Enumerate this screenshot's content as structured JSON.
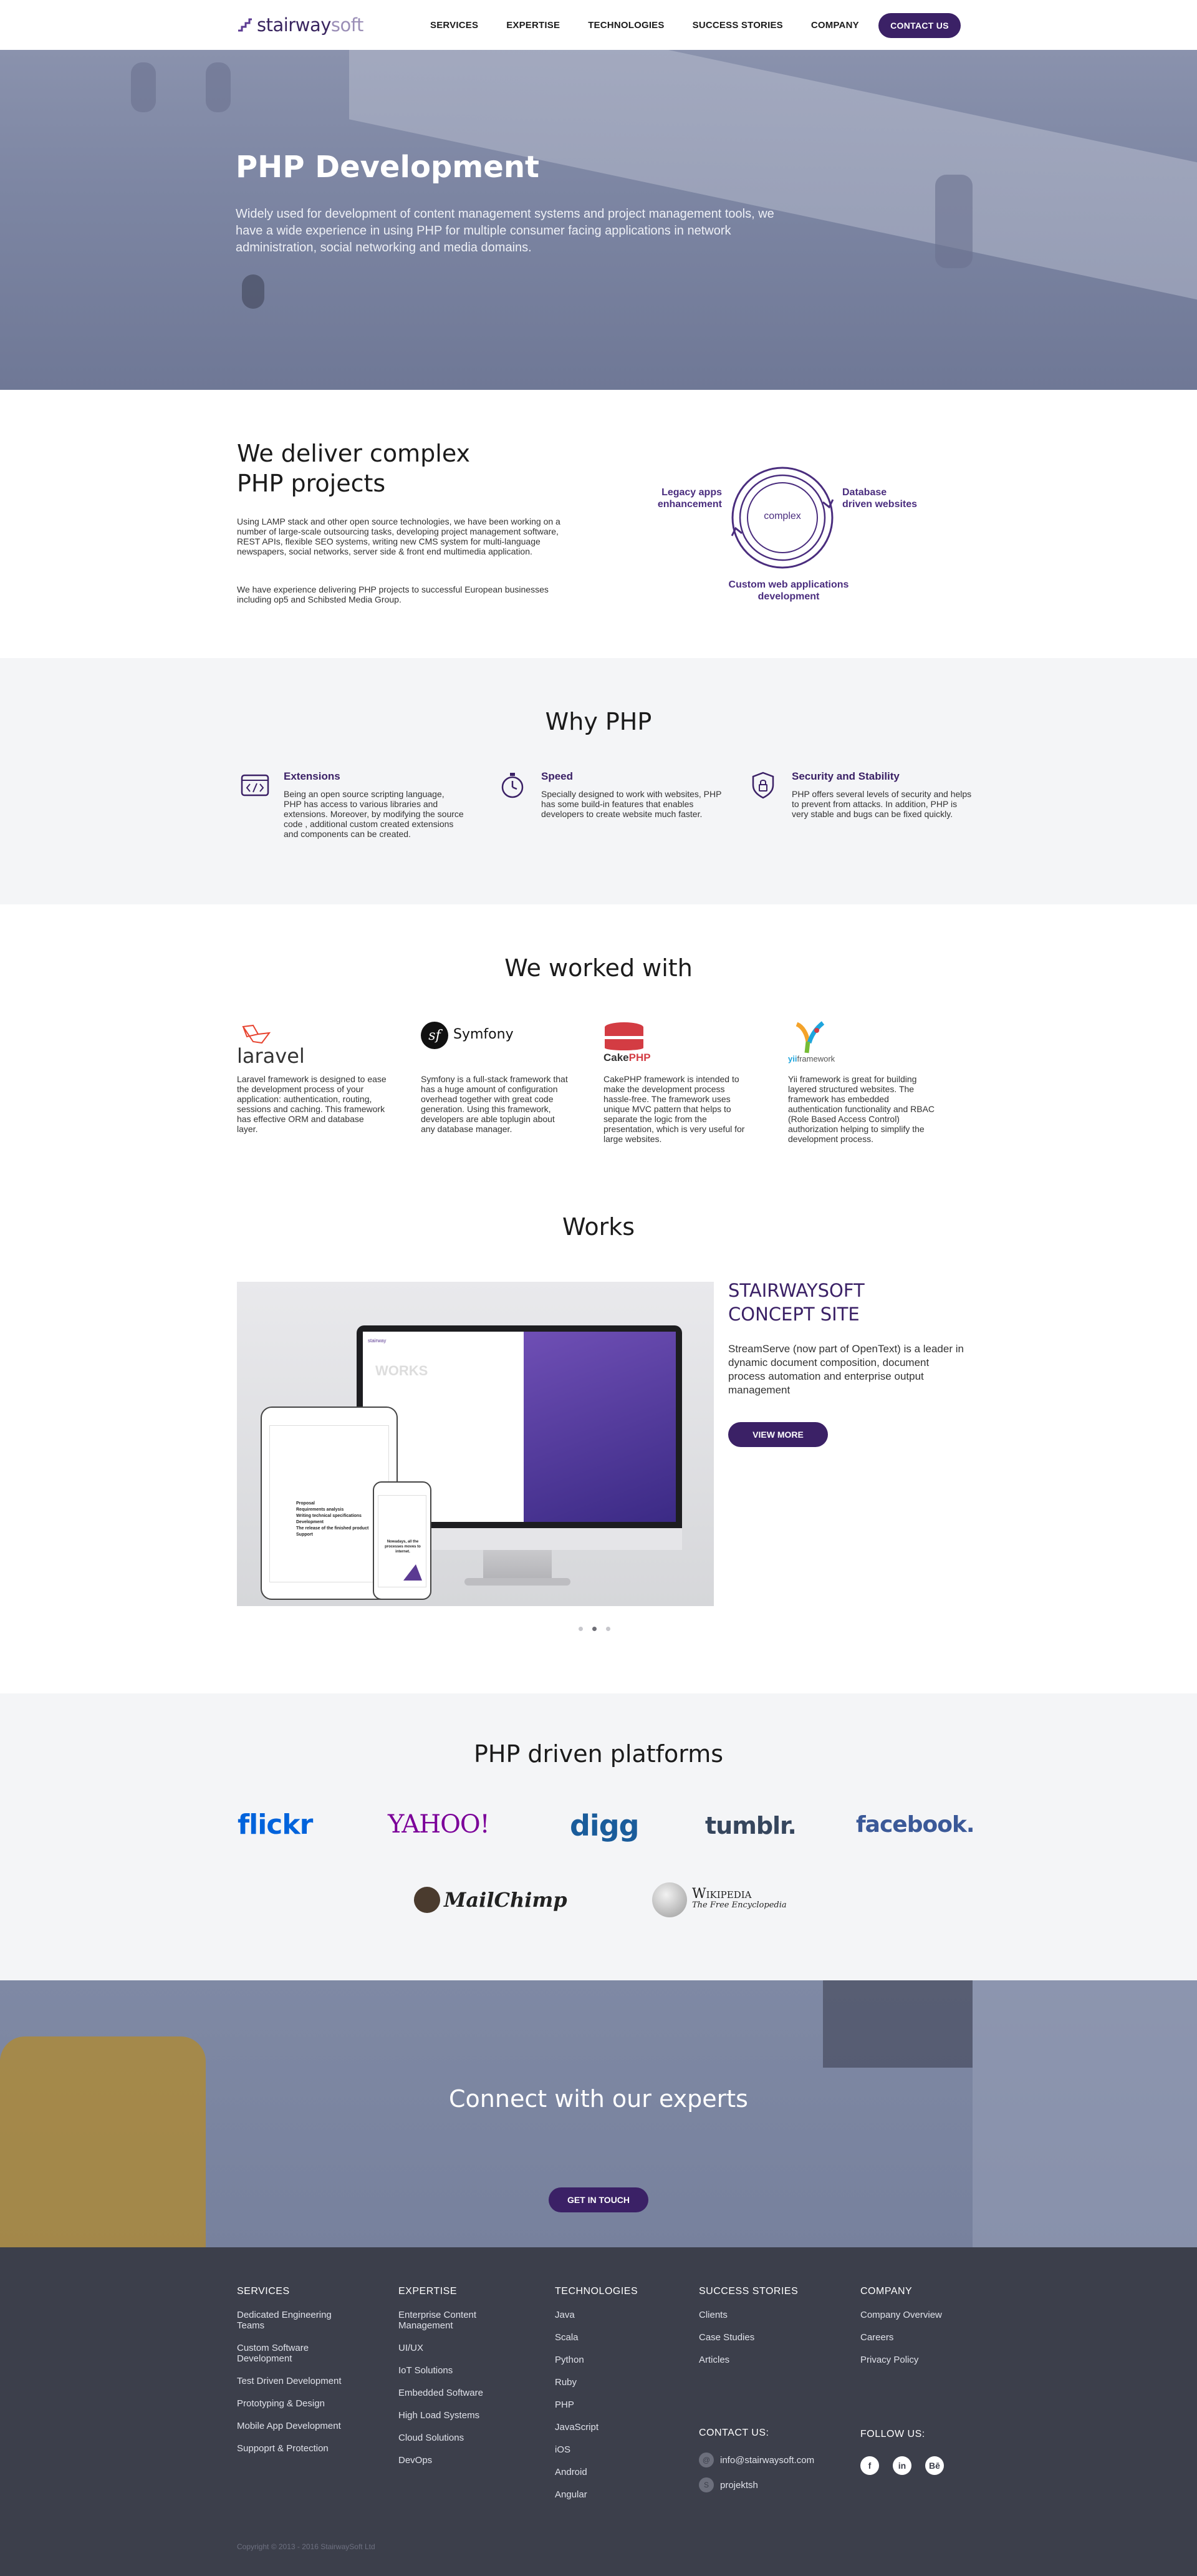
{
  "header": {
    "logo": {
      "part1": "stairway",
      "part2": "soft"
    },
    "nav": [
      "SERVICES",
      "EXPERTISE",
      "TECHNOLOGIES",
      "SUCCESS STORIES",
      "COMPANY"
    ],
    "contact_label": "CONTACT US"
  },
  "hero": {
    "title": "PHP Development",
    "description": "Widely used for development of content management systems and project management tools, we have a wide experience in using PHP for multiple consumer facing applications in network administration, social networking and media domains."
  },
  "deliver": {
    "title_line1": "We deliver complex",
    "title_line2": "PHP projects",
    "paragraph1": "Using LAMP stack and other open source technologies, we have been working on a number of large-scale outsourcing tasks, developing project management software, REST APIs, flexible SEO systems, writing new CMS system for multi-language newspapers, social networks, server side & front end multimedia application.",
    "paragraph2": "We have experience delivering PHP projects to successful European businesses including op5 and Schibsted Media Group.",
    "diagram": {
      "center": "complex",
      "left_line1": "Legacy apps",
      "left_line2": "enhancement",
      "right_line1": "Database",
      "right_line2": "driven websites",
      "bottom_line1": "Custom web applications",
      "bottom_line2": "development"
    }
  },
  "why": {
    "title": "Why PHP",
    "features": [
      {
        "icon": "code-window-icon",
        "title": "Extensions",
        "text": "Being an open source scripting language, PHP has access to various libraries and extensions. Moreover, by modifying the source code , additional custom created extensions and components can be created."
      },
      {
        "icon": "stopwatch-icon",
        "title": "Speed",
        "text": "Specially designed to work with websites, PHP has some build-in features that enables developers to create website much faster."
      },
      {
        "icon": "shield-lock-icon",
        "title": "Security and Stability",
        "text": "PHP offers several levels of security and helps to prevent from attacks. In addition, PHP is very stable and bugs can be fixed quickly."
      }
    ]
  },
  "worked": {
    "title": "We worked with",
    "frameworks": [
      {
        "name": "laravel",
        "text": "Laravel framework is designed to ease the development process of your application: authentication, routing, sessions and caching. This framework has effective ORM and database layer."
      },
      {
        "name": "Symfony",
        "text": "Symfony is a full-stack framework that has a huge amount of configuration overhead together with great code generation. Using this framework, developers are able toplugin about any database manager."
      },
      {
        "name_a": "Cake",
        "name_b": "PHP",
        "text": "CakePHP framework is intended to make the development process hassle-free. The framework uses unique MVC pattern that helps to separate the logic from the presentation, which is very useful for large websites."
      },
      {
        "name_a": "yii",
        "name_b": "framework",
        "text": "Yii framework is great for building layered structured websites. The framework has embedded authentication functionality and RBAC (Role Based Access Control) authorization helping to simplify the development process."
      }
    ]
  },
  "works": {
    "title": "Works",
    "project_title_line1": "STAIRWAYSOFT",
    "project_title_line2": "CONCEPT SITE",
    "project_desc": "StreamServe (now part of OpenText) is a leader in dynamic document composition, document process automation and enterprise output management",
    "view_more": "VIEW MORE",
    "slides_total": 3,
    "slide_active": 2,
    "mockup": {
      "screen_heading": "WORKS",
      "tablet_list": [
        "Proposal",
        "Requirements analysis",
        "Writing technical specifications",
        "Development",
        "The release of the finished product",
        "Support"
      ],
      "phone_text": "Nowadays, all the processes moves to internet."
    }
  },
  "platforms": {
    "title": "PHP driven platforms",
    "logos": [
      "flickr",
      "YAHOO!",
      "digg",
      "tumblr.",
      "facebook.",
      "MailChimp",
      "Wikipedia",
      "The Free Encyclopedia"
    ]
  },
  "connect": {
    "title": "Connect with our experts",
    "button": "GET IN TOUCH"
  },
  "footer": {
    "services": {
      "title": "SERVICES",
      "items": [
        "Dedicated Engineering Teams",
        "Custom Software Development",
        "Test Driven Development",
        "Prototyping & Design",
        "Mobile App Development",
        "Suppoprt & Protection"
      ]
    },
    "expertise": {
      "title": "EXPERTISE",
      "items": [
        "Enterprise Content Management",
        "UI/UX",
        "IoT Solutions",
        "Embedded Software",
        "High Load Systems",
        "Cloud Solutions",
        "DevOps"
      ]
    },
    "technologies": {
      "title": "TECHNOLOGIES",
      "items": [
        "Java",
        "Scala",
        "Python",
        "Ruby",
        "PHP",
        "JavaScript",
        "iOS",
        "Android",
        "Angular"
      ]
    },
    "stories": {
      "title": "SUCCESS STORIES",
      "items": [
        "Clients",
        "Case Studies",
        "Articles"
      ]
    },
    "company": {
      "title": "COMPANY",
      "items": [
        "Company Overview",
        "Careers",
        "Privacy Policy"
      ]
    },
    "contact": {
      "title": "CONTACT US:",
      "email": "info@stairwaysoft.com",
      "skype": "projektsh"
    },
    "follow": {
      "title": "FOLLOW US:",
      "icons": [
        "f",
        "in",
        "Bē"
      ]
    },
    "copyright": "Copyright © 2013 - 2016 StairwaySoft Ltd"
  }
}
